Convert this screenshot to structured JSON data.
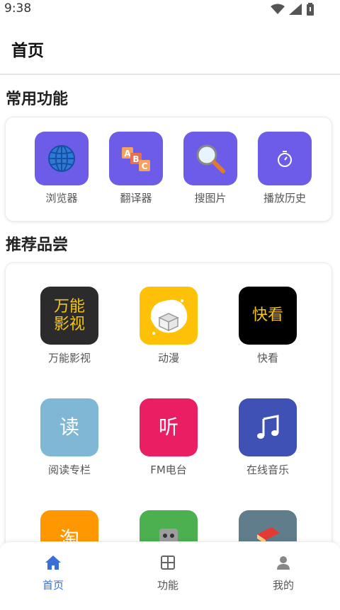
{
  "status_bar": {
    "time": "9:38"
  },
  "app_bar": {
    "title": "首页"
  },
  "common_section": {
    "title": "常用功能",
    "items": [
      {
        "label": "浏览器",
        "icon": "globe-icon",
        "color": "#6c5ce7"
      },
      {
        "label": "翻译器",
        "icon": "abc-blocks-icon",
        "color": "#6c5ce7"
      },
      {
        "label": "搜图片",
        "icon": "magnifier-icon",
        "color": "#6c5ce7"
      },
      {
        "label": "播放历史",
        "icon": "stopwatch-icon",
        "color": "#6c5ce7"
      }
    ]
  },
  "recommend_section": {
    "title": "推荐品尝",
    "items": [
      {
        "label": "万能影视",
        "icon_text": "万能\n影视",
        "color": "#2b2b2b",
        "text_color": "#f5c518"
      },
      {
        "label": "动漫",
        "icon": "box-icon",
        "color": "#ffc107"
      },
      {
        "label": "快看",
        "icon_text": "快看",
        "color": "#000000",
        "text_color": "#f5c518"
      },
      {
        "label": "阅读专栏",
        "icon_text": "读",
        "color": "#7fb7d4",
        "text_color": "#ffffff"
      },
      {
        "label": "FM电台",
        "icon_text": "听",
        "color": "#e91e63",
        "text_color": "#ffffff"
      },
      {
        "label": "在线音乐",
        "icon": "music-note-icon",
        "color": "#3f51b5"
      },
      {
        "icon_text": "淘",
        "color": "#ff9800",
        "text_color": "#ffffff"
      },
      {
        "icon": "robot-icon",
        "color": "#4caf50"
      },
      {
        "icon": "book-icon",
        "color": "#607d8b"
      }
    ]
  },
  "bottom_nav": {
    "items": [
      {
        "label": "首页",
        "icon": "home-icon",
        "active": true
      },
      {
        "label": "功能",
        "icon": "grid-icon",
        "active": false
      },
      {
        "label": "我的",
        "icon": "person-icon",
        "active": false
      }
    ],
    "active_color": "#3a6fd8"
  }
}
